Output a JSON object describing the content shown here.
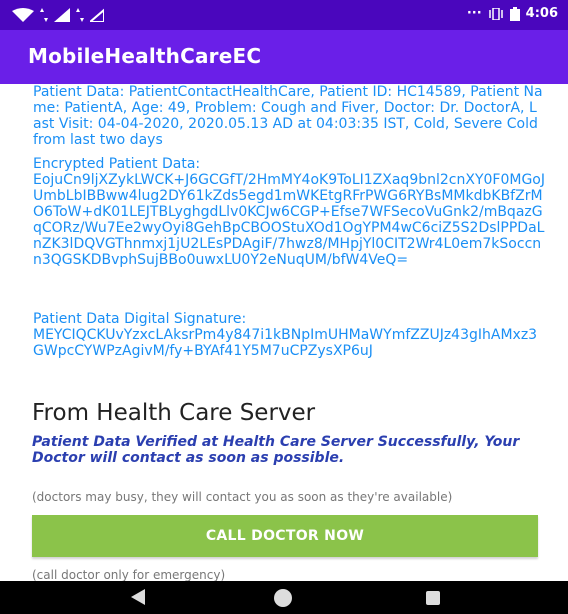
{
  "status_bar": {
    "notification_label": "···",
    "time": "4:06"
  },
  "app_bar": {
    "title": "MobileHealthCareEC"
  },
  "patient": {
    "data_text": "Patient Data: PatientContactHealthCare, Patient ID: HC14589, Patient Name: PatientA, Age: 49, Problem: Cough and Fiver, Doctor: Dr. DoctorA, Last Visit: 04-04-2020, 2020.05.13 AD at 04:03:35 IST, Cold, Severe Cold from last two days",
    "encrypted_label": "Encrypted Patient Data:",
    "encrypted_value": "EojuCn9ljXZykLWCK+J6GCGfT/2HmMY4oK9ToLI1ZXaq9bnl2cnXY0F0MGoJUmbLbIBBww4lug2DY61kZds5egd1mWKEtgRFrPWG6RYBsMMkdbKBfZrMO6ToW+dK01LEJTBLyghgdLlv0KCJw6CGP+Efse7WFSecoVuGnk2/mBqazGqCORz/Wu7Ee2wyOyi8GehBpCBOOStuXOd1OgYPM4wC6ciZ5S2DslPPDaLnZK3lDQVGThnmxj1jU2LEsPDAgiF/7hwz8/MHpjYl0CIT2Wr4L0em7kSoccnn3QGSKDBvphSujBBo0uwxLU0Y2eNuqUM/bfW4VeQ=",
    "signature_label": "Patient Data Digital Signature:",
    "signature_value": " MEYCIQCKUvYzxcLAksrPm4y847i1kBNpImUHMaWYmfZZUJz43gIhAMxz3GWpcCYWPzAgivM/fy+BYAf41Y5M7uCPZysXP6uJ"
  },
  "server": {
    "title": "From Health Care Server",
    "verified_text": "Patient Data Verified at Health Care Server Successfully, Your Doctor will contact as soon as possible.",
    "busy_note": "(doctors may busy, they will contact you as soon as they're available)",
    "call_button_label": "CALL DOCTOR NOW",
    "emergency_note": "(call doctor only for emergency)"
  },
  "colors": {
    "status_bar": "#4a06bd",
    "app_bar": "#6a1fe8",
    "patient_text": "#1a8ff5",
    "verified_text": "#2b3fb0",
    "call_button": "#8bc34a"
  }
}
